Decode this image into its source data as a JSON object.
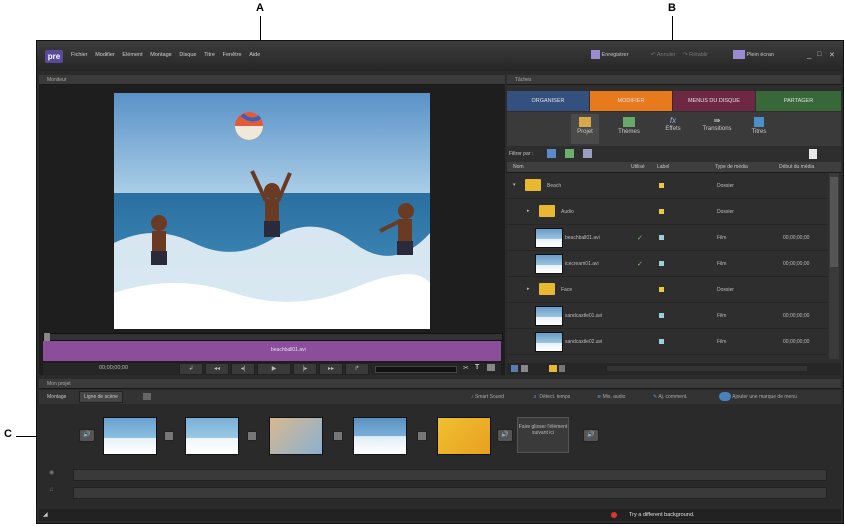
{
  "callouts": {
    "a": "A",
    "b": "B",
    "c": "C"
  },
  "app": {
    "logo": "pre",
    "menu": [
      "Fichier",
      "Modifier",
      "Elément",
      "Montage",
      "Disque",
      "Titre",
      "Fenêtre",
      "Aide"
    ],
    "top_buttons": {
      "save": "Enregistrer",
      "undo": "Annuler",
      "redo": "Rétablir",
      "fullscreen": "Plein écran"
    }
  },
  "monitor": {
    "title": "Moniteur",
    "clip_label": "beachball01.avi",
    "timecode": "00;00;00;00"
  },
  "tasks": {
    "title": "Tâches",
    "tabs": [
      {
        "label": "ORGANISER",
        "color": "#3a5a8a"
      },
      {
        "label": "MODIFIER",
        "color": "#e87a1e"
      },
      {
        "label": "MENUS DU DISQUE",
        "color": "#7a2a4a"
      },
      {
        "label": "PARTAGER",
        "color": "#3a6a3a"
      }
    ],
    "subtabs": [
      {
        "icon": "project-icon",
        "label": "Projet"
      },
      {
        "icon": "themes-icon",
        "label": "Thèmes"
      },
      {
        "icon": "effects-icon",
        "label": "Effets"
      },
      {
        "icon": "transitions-icon",
        "label": "Transitions"
      },
      {
        "icon": "titles-icon",
        "label": "Titres"
      }
    ],
    "filter_label": "Filtrer par :",
    "columns": [
      "Nom",
      "Utilisé",
      "Label",
      "Type de média",
      "Début du média"
    ],
    "rows": [
      {
        "name": "Beach",
        "used": "",
        "type": "Dossier",
        "start": "",
        "kind": "folder",
        "indent": 0,
        "label_color": "#e8c84a"
      },
      {
        "name": "Audio",
        "used": "",
        "type": "Dossier",
        "start": "",
        "kind": "folder",
        "indent": 1,
        "label_color": "#e8c84a"
      },
      {
        "name": "beachball01.avi",
        "used": "✓",
        "type": "Film",
        "start": "00;00;00;00",
        "kind": "clip",
        "indent": 2,
        "label_color": "#9ad0d8"
      },
      {
        "name": "icecream01.avi",
        "used": "✓",
        "type": "Film",
        "start": "00;00;00;00",
        "kind": "clip",
        "indent": 2,
        "label_color": "#9ad0d8"
      },
      {
        "name": "Face",
        "used": "",
        "type": "Dossier",
        "start": "",
        "kind": "folder",
        "indent": 1,
        "label_color": "#e8c84a"
      },
      {
        "name": "sandcastle01.avi",
        "used": "",
        "type": "Film",
        "start": "00;00;00;00",
        "kind": "clip",
        "indent": 2,
        "label_color": "#9ad0d8"
      },
      {
        "name": "sandcastle02.avi",
        "used": "",
        "type": "Film",
        "start": "00;00;00;00",
        "kind": "clip",
        "indent": 2,
        "label_color": "#9ad0d8"
      }
    ]
  },
  "project": {
    "title": "Mon projet",
    "views": {
      "montage": "Montage",
      "scene_line": "Ligne de scène"
    },
    "tools": [
      "Smart Sound",
      "Détect. temps",
      "Mix. audio",
      "Aj. comment.",
      "Ajouter une marque de menu"
    ],
    "drop_hint": "Faire glisser l'élément suivant ici",
    "status": "Try a different background."
  }
}
